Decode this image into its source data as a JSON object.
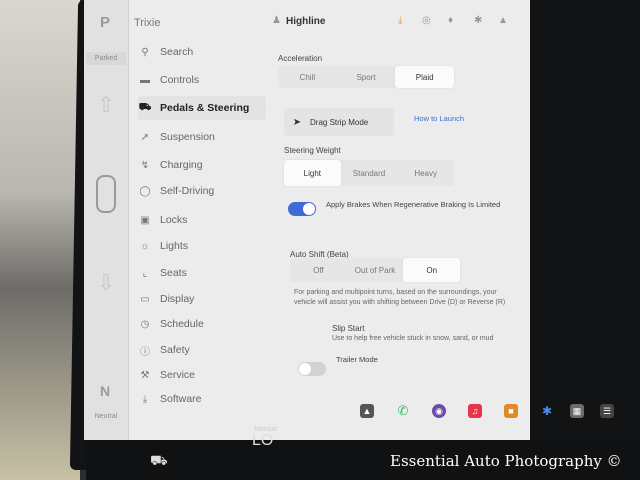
{
  "strip": {
    "gear_top": "P",
    "parked": "Parked",
    "gear_bottom": "N",
    "neutral": "Neutral"
  },
  "profile": "Trixie",
  "topbar": {
    "user": "Highline"
  },
  "sidebar": {
    "items": [
      {
        "label": "Search",
        "icon": "search-icon"
      },
      {
        "label": "Controls",
        "icon": "toggle-icon"
      },
      {
        "label": "Pedals & Steering",
        "icon": "car-icon"
      },
      {
        "label": "Suspension",
        "icon": "suspension-icon"
      },
      {
        "label": "Charging",
        "icon": "bolt-icon"
      },
      {
        "label": "Self-Driving",
        "icon": "steering-wheel-icon"
      },
      {
        "label": "Locks",
        "icon": "lock-icon"
      },
      {
        "label": "Lights",
        "icon": "sun-icon"
      },
      {
        "label": "Seats",
        "icon": "seat-icon"
      },
      {
        "label": "Display",
        "icon": "display-icon"
      },
      {
        "label": "Schedule",
        "icon": "clock-icon"
      },
      {
        "label": "Safety",
        "icon": "info-icon"
      },
      {
        "label": "Service",
        "icon": "wrench-icon"
      },
      {
        "label": "Software",
        "icon": "download-icon"
      }
    ],
    "active_index": 2
  },
  "settings": {
    "acceleration": {
      "label": "Acceleration",
      "options": [
        "Chill",
        "Sport",
        "Plaid"
      ],
      "selected": "Plaid"
    },
    "drag_strip": {
      "label": "Drag Strip Mode",
      "link": "How to Launch"
    },
    "steering": {
      "label": "Steering Weight",
      "options": [
        "Light",
        "Standard",
        "Heavy"
      ],
      "selected": "Light"
    },
    "regen": {
      "label": "Apply Brakes When Regenerative Braking Is Limited",
      "enabled": true
    },
    "auto_shift": {
      "label": "Auto Shift (Beta)",
      "options": [
        "Off",
        "Out of Park",
        "On"
      ],
      "selected": "On",
      "description": "For parking and multipoint turns, based on the surroundings, your vehicle will assist you with shifting between Drive (D) or Reverse (R)"
    },
    "slip_start": {
      "label": "Slip Start",
      "description": "Use to help free vehicle stuck in snow, sand, or mud"
    },
    "trailer": {
      "label": "Trailer Mode",
      "enabled": false
    }
  },
  "bottom": {
    "temp_mode": "Manual",
    "temp": "LO"
  },
  "watermark": "Essential Auto Photography ©",
  "colors": {
    "accent": "#3a6fd0",
    "toggle_on": "#3e6bd6"
  }
}
